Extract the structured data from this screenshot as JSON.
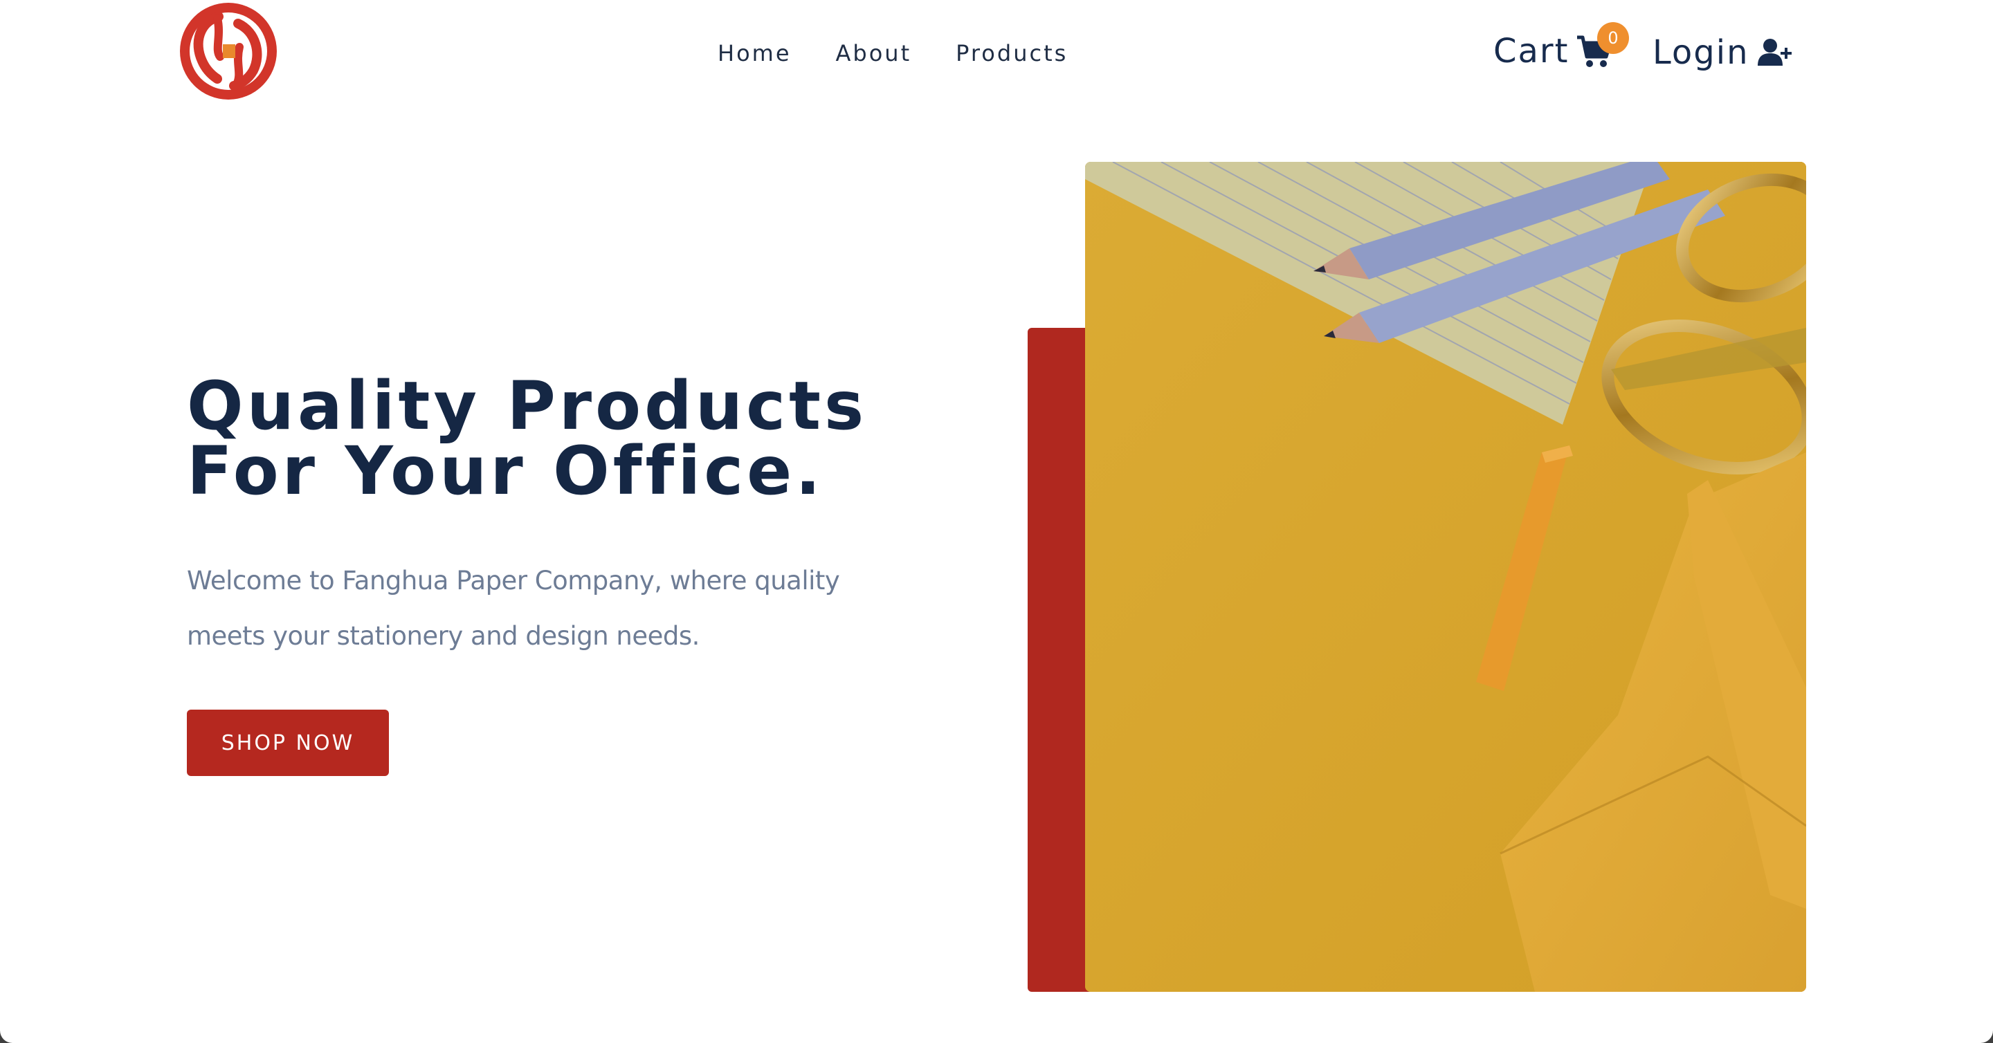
{
  "brand": {
    "logo_icon": "fanghua-logo-icon",
    "colors": {
      "accent_red": "#b5281f",
      "navy": "#152744",
      "badge_orange": "#ef8f2e",
      "muted_text": "#6d7c95"
    }
  },
  "nav": {
    "items": [
      {
        "label": "Home"
      },
      {
        "label": "About"
      },
      {
        "label": "Products"
      }
    ]
  },
  "header": {
    "cart_label": "Cart",
    "cart_icon": "shopping-cart-icon",
    "cart_count": "0",
    "login_label": "Login",
    "login_icon": "user-plus-icon"
  },
  "hero": {
    "title_line1": "Quality Products",
    "title_line2": "For Your Office.",
    "subtitle_line1": "Welcome to Fanghua Paper Company, where quality",
    "subtitle_line2": "meets your stationery and design needs.",
    "cta_label": "SHOP NOW",
    "image": "office-supplies-photo"
  }
}
